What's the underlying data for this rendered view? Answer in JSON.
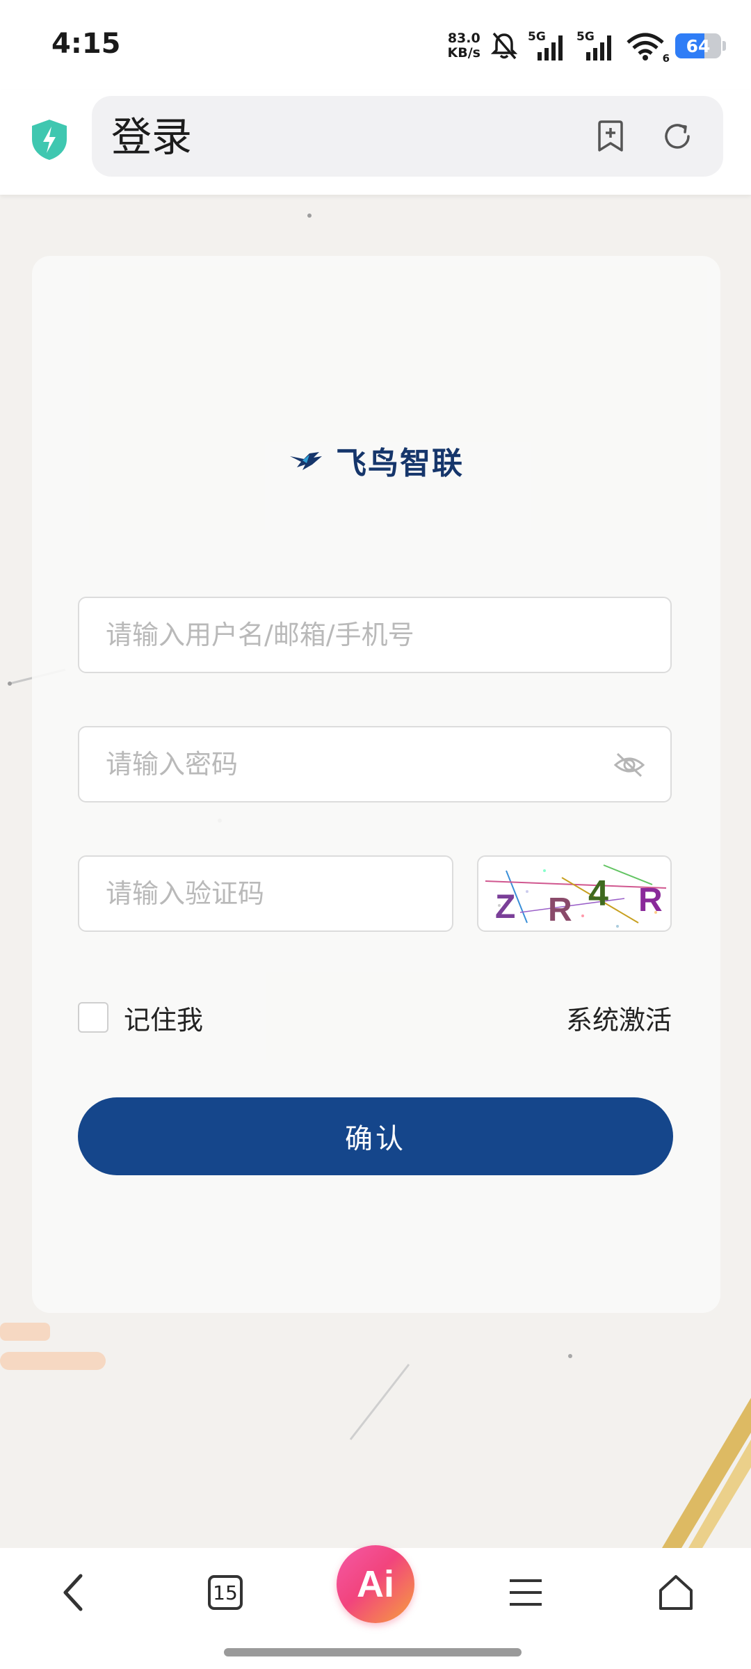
{
  "status_bar": {
    "time": "4:15",
    "net_speed_value": "83.0",
    "net_speed_unit": "KB/s",
    "signal_1_tag": "5G",
    "signal_2_tag": "5G",
    "wifi_tag": "6",
    "battery_level": "64",
    "battery_color": "#2f7df6"
  },
  "browser": {
    "page_title": "登录",
    "shield_icon": "lightning-shield-icon",
    "add_bookmark_icon": "bookmark-add-icon",
    "refresh_icon": "refresh-icon"
  },
  "login": {
    "brand_name": "飞鸟智联",
    "brand_color": "#16366b",
    "username_placeholder": "请输入用户名/邮箱/手机号",
    "password_placeholder": "请输入密码",
    "captcha_placeholder": "请输入验证码",
    "captcha_chars": [
      "Z",
      "R",
      "4",
      "R"
    ],
    "remember_label": "记住我",
    "activate_label": "系统激活",
    "confirm_label": "确认",
    "confirm_color": "#15468b"
  },
  "bottom_nav": {
    "tab_count": "15",
    "ai_label": "Ai",
    "icons": [
      "back-icon",
      "tabs-icon",
      "ai-icon",
      "menu-icon",
      "home-icon"
    ]
  }
}
